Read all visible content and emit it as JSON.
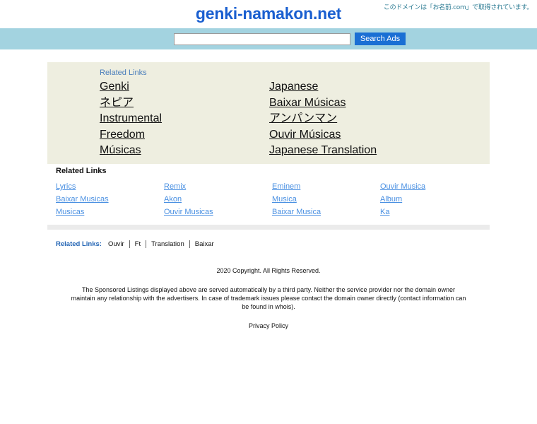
{
  "header": {
    "domain_title": "genki-namakon.net",
    "registrar_note": "このドメインは「お名前.com」で取得されています。",
    "title_color": "#1a5fd0"
  },
  "search": {
    "value": "",
    "placeholder": "",
    "button_label": "Search Ads",
    "band_color": "#a3d3e0",
    "button_color": "#1a6fd4"
  },
  "ads_panel": {
    "label": "Related Links",
    "background_color": "#eeeee0",
    "label_color": "#4a7ebb",
    "left_column": [
      {
        "label": "Genki"
      },
      {
        "label": "ネピア"
      },
      {
        "label": "Instrumental"
      },
      {
        "label": "Freedom"
      },
      {
        "label": "Músicas"
      }
    ],
    "right_column": [
      {
        "label": "Japanese"
      },
      {
        "label": "Baixar Músicas"
      },
      {
        "label": "アンパンマン"
      },
      {
        "label": "Ouvir Músicas"
      },
      {
        "label": "Japanese Translation"
      }
    ]
  },
  "related_table": {
    "title": "Related Links",
    "link_color": "#4a90e2",
    "columns": [
      {
        "items": [
          {
            "label": "Lyrics"
          },
          {
            "label": "Baixar Musicas"
          },
          {
            "label": "Musicas"
          }
        ]
      },
      {
        "items": [
          {
            "label": "Remix"
          },
          {
            "label": "Akon"
          },
          {
            "label": "Ouvir Musicas"
          }
        ]
      },
      {
        "items": [
          {
            "label": "Eminem"
          },
          {
            "label": "Musica"
          },
          {
            "label": "Baixar Musica"
          }
        ]
      },
      {
        "items": [
          {
            "label": "Ouvir Musica"
          },
          {
            "label": "Album"
          },
          {
            "label": "Ka"
          }
        ]
      }
    ]
  },
  "bottom_bar": {
    "label": "Related Links:",
    "items": [
      {
        "label": "Ouvir"
      },
      {
        "label": "Ft"
      },
      {
        "label": "Translation"
      },
      {
        "label": "Baixar"
      }
    ]
  },
  "footer": {
    "copyright": "2020 Copyright. All Rights Reserved.",
    "disclaimer": "The Sponsored Listings displayed above are served automatically by a third party. Neither the service provider nor the domain owner maintain any relationship with the advertisers. In case of trademark issues please contact the domain owner directly (contact information can be found in whois).",
    "privacy_policy": "Privacy Policy"
  }
}
